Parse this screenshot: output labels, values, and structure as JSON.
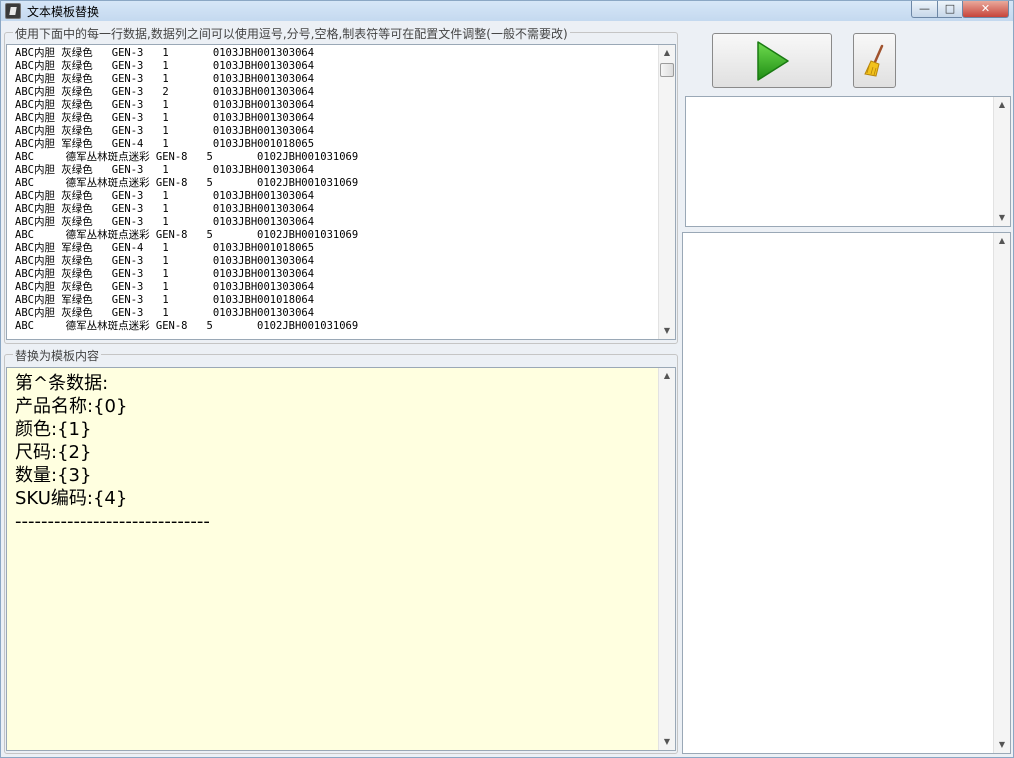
{
  "window": {
    "title": "文本模板替换",
    "minimize_label": "—",
    "maximize_label": "□",
    "close_label": "✕"
  },
  "colors": {
    "titlebar": "#c4d9ef",
    "template_background": "#ffffe0",
    "play_green": "#2fae1f",
    "close_red": "#c7443a"
  },
  "data_group": {
    "label": "使用下面中的每一行数据,数据列之间可以使用逗号,分号,空格,制表符等可在配置文件调整(一般不需要改)",
    "lines": [
      "ABC内胆 灰绿色   GEN-3   1       0103JBH001303064",
      "ABC内胆 灰绿色   GEN-3   1       0103JBH001303064",
      "ABC内胆 灰绿色   GEN-3   1       0103JBH001303064",
      "ABC内胆 灰绿色   GEN-3   2       0103JBH001303064",
      "ABC内胆 灰绿色   GEN-3   1       0103JBH001303064",
      "ABC内胆 灰绿色   GEN-3   1       0103JBH001303064",
      "ABC内胆 灰绿色   GEN-3   1       0103JBH001303064",
      "ABC内胆 军绿色   GEN-4   1       0103JBH001018065",
      "ABC     德军丛林斑点迷彩 GEN-8   5       0102JBH001031069",
      "ABC内胆 灰绿色   GEN-3   1       0103JBH001303064",
      "ABC     德军丛林斑点迷彩 GEN-8   5       0102JBH001031069",
      "ABC内胆 灰绿色   GEN-3   1       0103JBH001303064",
      "ABC内胆 灰绿色   GEN-3   1       0103JBH001303064",
      "ABC内胆 灰绿色   GEN-3   1       0103JBH001303064",
      "ABC     德军丛林斑点迷彩 GEN-8   5       0102JBH001031069",
      "ABC内胆 军绿色   GEN-4   1       0103JBH001018065",
      "ABC内胆 灰绿色   GEN-3   1       0103JBH001303064",
      "ABC内胆 灰绿色   GEN-3   1       0103JBH001303064",
      "ABC内胆 灰绿色   GEN-3   1       0103JBH001303064",
      "ABC内胆 军绿色   GEN-3   1       0103JBH001018064",
      "ABC内胆 灰绿色   GEN-3   1       0103JBH001303064",
      "ABC     德军丛林斑点迷彩 GEN-8   5       0102JBH001031069"
    ]
  },
  "template_group": {
    "label": "替换为模板内容",
    "lines": [
      "第^条数据:",
      "产品名称:{0}",
      "颜色:{1}",
      "尺码:{2}",
      "数量:{3}",
      "SKU编码:{4}",
      "------------------------------"
    ]
  },
  "toolbar": {
    "run_icon": "play-icon",
    "clear_icon": "broom-icon"
  },
  "scrollbar": {
    "up_arrow": "▲",
    "down_arrow": "▼"
  }
}
